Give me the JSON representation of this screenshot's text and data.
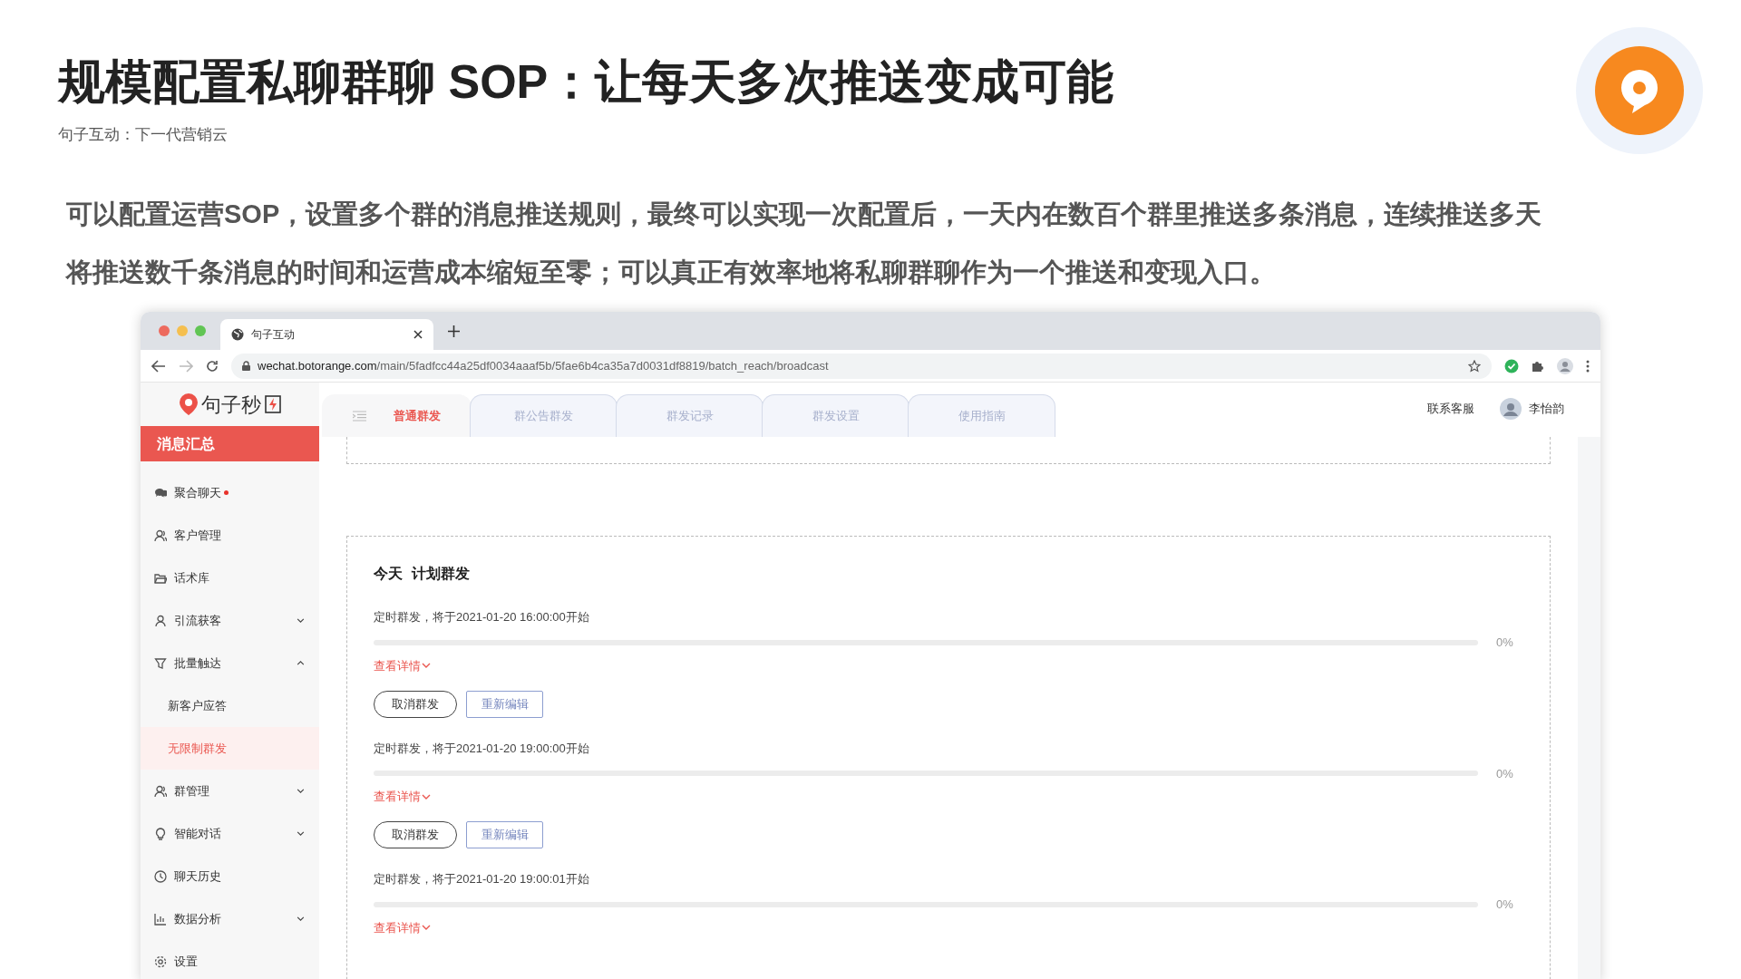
{
  "slide": {
    "title": "规模配置私聊群聊 SOP：让每天多次推送变成可能",
    "subtitle": "句子互动：下一代营销云",
    "description": [
      "可以配置运营SOP，设置多个群的消息推送规则，最终可以实现一次配置后，一天内在数百个群里推送多条消息，连续推送多天",
      "将推送数千条消息的时间和运营成本缩短至零；可以真正有效率地将私聊群聊作为一个推送和变现入口。"
    ]
  },
  "browser": {
    "tab_title": "句子互动",
    "url_host": "wechat.botorange.com",
    "url_path": "/main/5fadfcc44a25df0034aaaf5b/5fae6b4ca35a7d0031df8819/batch_reach/broadcast"
  },
  "app": {
    "brand": "句子秒",
    "sidebar": {
      "header": "消息汇总",
      "items": [
        {
          "label": "聚合聊天",
          "badge": true
        },
        {
          "label": "客户管理"
        },
        {
          "label": "话术库"
        },
        {
          "label": "引流获客",
          "expanded": false
        },
        {
          "label": "批量触达",
          "expanded": true,
          "children": [
            {
              "label": "新客户应答",
              "selected": false
            },
            {
              "label": "无限制群发",
              "selected": true
            }
          ]
        },
        {
          "label": "群管理",
          "expanded": false
        },
        {
          "label": "智能对话",
          "expanded": false
        },
        {
          "label": "聊天历史"
        },
        {
          "label": "数据分析",
          "expanded": false
        },
        {
          "label": "设置"
        }
      ]
    },
    "tabs": [
      {
        "label": "普通群发",
        "selected": true
      },
      {
        "label": "群公告群发",
        "selected": false
      },
      {
        "label": "群发记录",
        "selected": false
      },
      {
        "label": "群发设置",
        "selected": false
      },
      {
        "label": "使用指南",
        "selected": false
      }
    ],
    "header_links": {
      "support": "联系客服",
      "user": "李怡韵"
    },
    "section": {
      "day": "今天",
      "title": "计划群发"
    },
    "broadcasts": [
      {
        "text": "定时群发，将于2021-01-20 16:00:00开始",
        "level": 0,
        "reading": "0%",
        "detail_link": "查看详情",
        "buttons": [
          {
            "kind": "outline",
            "label": "取消群发"
          },
          {
            "kind": "primary",
            "label": "重新编辑"
          }
        ]
      },
      {
        "text": "定时群发，将于2021-01-20 19:00:00开始",
        "level": 0,
        "reading": "0%",
        "detail_link": "查看详情",
        "buttons": [
          {
            "kind": "outline",
            "label": "取消群发"
          },
          {
            "kind": "primary",
            "label": "重新编辑"
          }
        ]
      },
      {
        "text": "定时群发，将于2021-01-20 19:00:01开始",
        "level": 0,
        "reading": "0%",
        "detail_link": "查看详情"
      }
    ]
  }
}
